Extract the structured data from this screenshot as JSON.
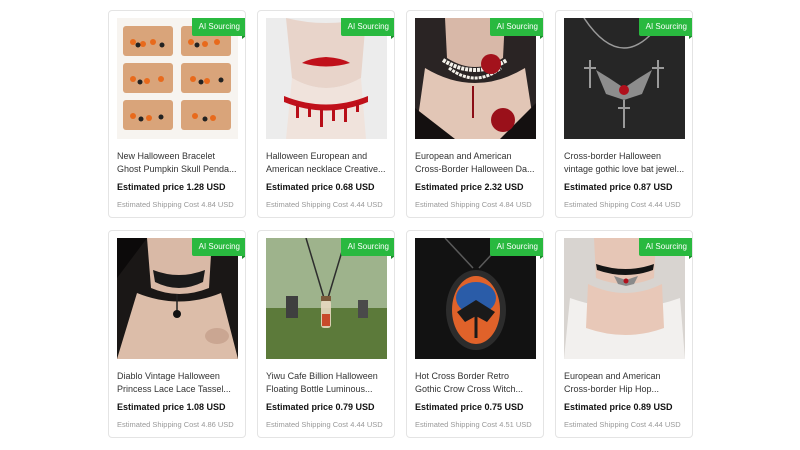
{
  "badge_label": "AI Sourcing",
  "products": [
    {
      "title_line1": "New Halloween Bracelet",
      "title_line2": "Ghost Pumpkin Skull Penda...",
      "price": "Estimated price 1.28 USD",
      "shipping": "Estimated Shipping Cost 4.84 USD",
      "image": "bracelet-set-image"
    },
    {
      "title_line1": "Halloween European and",
      "title_line2": "American necklace Creative...",
      "price": "Estimated price 0.68 USD",
      "shipping": "Estimated Shipping Cost 4.44 USD",
      "image": "blood-choker-image"
    },
    {
      "title_line1": "European and American",
      "title_line2": "Cross-Border Halloween Da...",
      "price": "Estimated price 2.32 USD",
      "shipping": "Estimated Shipping Cost 4.84 USD",
      "image": "pearl-rose-necklace-image"
    },
    {
      "title_line1": "Cross-border Halloween",
      "title_line2": "vintage gothic love bat jewel...",
      "price": "Estimated price 0.87 USD",
      "shipping": "Estimated Shipping Cost 4.44 USD",
      "image": "bat-necklace-image"
    },
    {
      "title_line1": "Diablo Vintage Halloween",
      "title_line2": "Princess Lace Lace Tassel...",
      "price": "Estimated price 1.08 USD",
      "shipping": "Estimated Shipping Cost 4.86 USD",
      "image": "lace-choker-image"
    },
    {
      "title_line1": "Yiwu Cafe Billion Halloween",
      "title_line2": "Floating Bottle Luminous...",
      "price": "Estimated price 0.79 USD",
      "shipping": "Estimated Shipping Cost 4.44 USD",
      "image": "bottle-pendant-image"
    },
    {
      "title_line1": "Hot Cross Border Retro",
      "title_line2": "Gothic Crow Cross Witch...",
      "price": "Estimated price 0.75 USD",
      "shipping": "Estimated Shipping Cost 4.51 USD",
      "image": "crow-pendant-image"
    },
    {
      "title_line1": "European and American",
      "title_line2": "Cross-border Hip Hop...",
      "price": "Estimated price 0.89 USD",
      "shipping": "Estimated Shipping Cost 4.44 USD",
      "image": "bat-choker-image"
    }
  ]
}
